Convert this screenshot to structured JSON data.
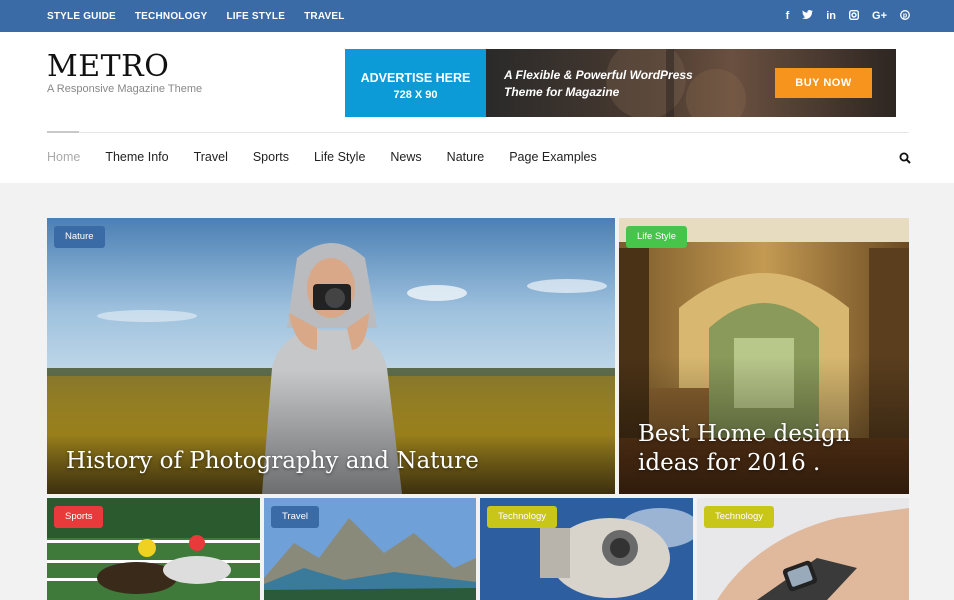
{
  "topbar": {
    "links": [
      "STYLE GUIDE",
      "TECHNOLOGY",
      "LIFE STYLE",
      "TRAVEL"
    ],
    "social_icons": [
      "facebook-icon",
      "twitter-icon",
      "linkedin-icon",
      "instagram-icon",
      "google-plus-icon",
      "pinterest-icon"
    ],
    "bg_color": "#3a6ba6"
  },
  "brand": {
    "name": "METRO",
    "tagline": "A Responsive Magazine Theme"
  },
  "ad": {
    "left_line1": "ADVERTISE HERE",
    "left_line2": "728 X 90",
    "text_line1": "A Flexible & Powerful WordPress",
    "text_line2": "Theme for Magazine",
    "button": "BUY NOW",
    "accent": "#0d9bd7",
    "button_color": "#f7941d"
  },
  "nav": {
    "items": [
      "Home",
      "Theme Info",
      "Travel",
      "Sports",
      "Life Style",
      "News",
      "Nature",
      "Page Examples"
    ],
    "active": "Home"
  },
  "featured": [
    {
      "category": "Nature",
      "title": "History of Photography and Nature",
      "badge_color": "#3a6ba6"
    },
    {
      "category": "Life Style",
      "title_line1": "Best Home design",
      "title_line2": "ideas for 2016 .",
      "badge_color": "#47c44a"
    }
  ],
  "thumbs": [
    {
      "category": "Sports",
      "badge_color": "#e83a3a"
    },
    {
      "category": "Travel",
      "badge_color": "#3a6ba6"
    },
    {
      "category": "Technology",
      "badge_color": "#c9c61a"
    },
    {
      "category": "Technology",
      "badge_color": "#c9c61a"
    }
  ]
}
